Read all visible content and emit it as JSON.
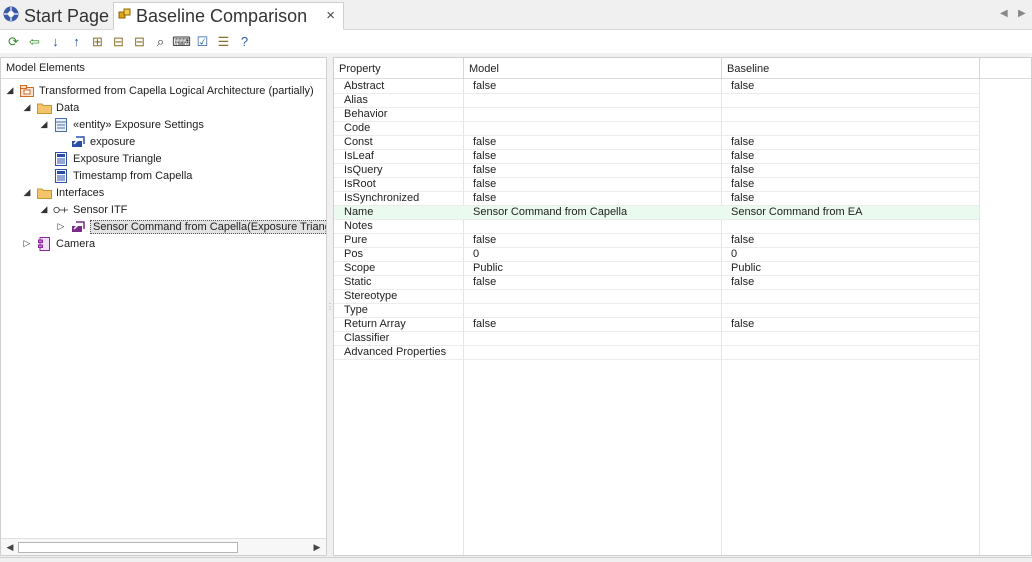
{
  "tabs": {
    "start_label": "Start Page",
    "active_label": "Baseline Comparison",
    "close_glyph": "×",
    "nav_left": "◀",
    "nav_right": "▶"
  },
  "toolbar": {
    "buttons": [
      {
        "name": "refresh-icon",
        "glyph": "⟳",
        "color": "#2e8b2e"
      },
      {
        "name": "back-arrow-icon",
        "glyph": "⇦",
        "color": "#2e8b2e"
      },
      {
        "name": "arrow-down-icon",
        "glyph": "↓",
        "color": "#2a5aa8"
      },
      {
        "name": "arrow-up-icon",
        "glyph": "↑",
        "color": "#2a5aa8"
      },
      {
        "name": "tree-expand-icon",
        "glyph": "⊞",
        "color": "#8a6d2a"
      },
      {
        "name": "tree-move-up-icon",
        "glyph": "⊟",
        "color": "#8a6d2a"
      },
      {
        "name": "tree-move-down-icon",
        "glyph": "⊟",
        "color": "#8a6d2a"
      },
      {
        "name": "find-icon",
        "glyph": "⌕",
        "color": "#333333"
      },
      {
        "name": "xml-icon",
        "glyph": "⌨",
        "color": "#333333"
      },
      {
        "name": "checklist-icon",
        "glyph": "☑",
        "color": "#2a5aa8"
      },
      {
        "name": "filter-list-icon",
        "glyph": "☰",
        "color": "#8a6d2a"
      },
      {
        "name": "help-icon",
        "glyph": "?",
        "color": "#2a5aa8"
      }
    ]
  },
  "tree": {
    "header": "Model Elements",
    "items": [
      {
        "label": "Transformed from Capella Logical Architecture (partially)",
        "icon": "package-icon",
        "twisty": "◢",
        "selected": false
      },
      {
        "label": "Data",
        "icon": "folder-icon",
        "twisty": "◢",
        "selected": false
      },
      {
        "label": "«entity» Exposure Settings",
        "icon": "class-icon",
        "twisty": "◢",
        "selected": false
      },
      {
        "label": "exposure",
        "icon": "attribute-icon",
        "twisty": "",
        "selected": false
      },
      {
        "label": "Exposure Triangle",
        "icon": "diagram-icon",
        "twisty": "",
        "selected": false
      },
      {
        "label": "Timestamp from Capella",
        "icon": "diagram-icon",
        "twisty": "",
        "selected": false
      },
      {
        "label": "Interfaces",
        "icon": "folder-icon",
        "twisty": "◢",
        "selected": false
      },
      {
        "label": "Sensor ITF",
        "icon": "interface-icon",
        "twisty": "◢",
        "selected": false
      },
      {
        "label": "Sensor Command from Capella(Exposure Triangl",
        "icon": "operation-icon",
        "twisty": "▷",
        "selected": true
      },
      {
        "label": "Camera",
        "icon": "component-icon",
        "twisty": "▷",
        "selected": false
      }
    ]
  },
  "grid": {
    "headers": [
      "Property",
      "Model",
      "Baseline"
    ],
    "rows": [
      {
        "property": "Abstract",
        "model": "false",
        "baseline": "false",
        "highlight": false
      },
      {
        "property": "Alias",
        "model": "",
        "baseline": "",
        "highlight": false
      },
      {
        "property": "Behavior",
        "model": "",
        "baseline": "",
        "highlight": false
      },
      {
        "property": "Code",
        "model": "",
        "baseline": "",
        "highlight": false
      },
      {
        "property": "Const",
        "model": "false",
        "baseline": "false",
        "highlight": false
      },
      {
        "property": "IsLeaf",
        "model": "false",
        "baseline": "false",
        "highlight": false
      },
      {
        "property": "IsQuery",
        "model": "false",
        "baseline": "false",
        "highlight": false
      },
      {
        "property": "IsRoot",
        "model": "false",
        "baseline": "false",
        "highlight": false
      },
      {
        "property": "IsSynchronized",
        "model": "false",
        "baseline": "false",
        "highlight": false
      },
      {
        "property": "Name",
        "model": "Sensor Command from Capella",
        "baseline": "Sensor Command from EA",
        "highlight": true
      },
      {
        "property": "Notes",
        "model": "",
        "baseline": "",
        "highlight": false
      },
      {
        "property": "Pure",
        "model": "false",
        "baseline": "false",
        "highlight": false
      },
      {
        "property": "Pos",
        "model": "0",
        "baseline": "0",
        "highlight": false
      },
      {
        "property": "Scope",
        "model": "Public",
        "baseline": "Public",
        "highlight": false
      },
      {
        "property": "Static",
        "model": "false",
        "baseline": "false",
        "highlight": false
      },
      {
        "property": "Stereotype",
        "model": "",
        "baseline": "",
        "highlight": false
      },
      {
        "property": "Type",
        "model": "",
        "baseline": "",
        "highlight": false
      },
      {
        "property": "Return Array",
        "model": "false",
        "baseline": "false",
        "highlight": false
      },
      {
        "property": "Classifier",
        "model": "",
        "baseline": "",
        "highlight": false
      },
      {
        "property": "Advanced Properties",
        "model": "",
        "baseline": "",
        "highlight": false
      }
    ]
  },
  "colors": {
    "highlight_row": "#eafaee",
    "selection": "#e2e2e2"
  }
}
